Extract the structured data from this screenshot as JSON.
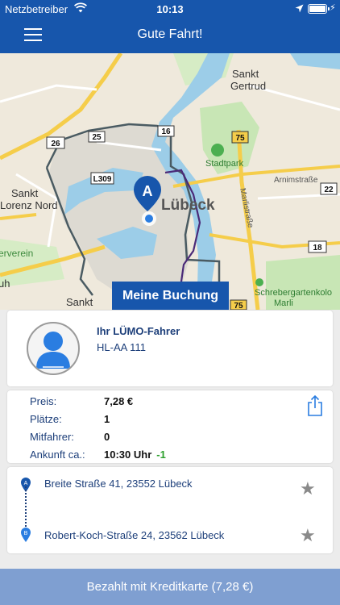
{
  "status_bar": {
    "carrier": "Netzbetreiber",
    "time": "10:13"
  },
  "nav": {
    "title": "Gute Fahrt!"
  },
  "map": {
    "labels": {
      "sankt_gertrud": [
        "Sankt",
        "Gertrud"
      ],
      "sankt_lorenz": [
        "Sankt",
        "Lorenz Nord"
      ],
      "stadtpark": "Stadtpark",
      "luebeck": "Lübeck",
      "arnimstrasse": "Arnimstraße",
      "marlistrasse": "Marlistraße",
      "schrebergarten": [
        "Schrebergartenkolo",
        "Marli"
      ],
      "erverein": "erverein",
      "uh": "uh",
      "sankt_bottom": "Sankt"
    },
    "road_shields": [
      "25",
      "16",
      "26",
      "75",
      "L309",
      "22",
      "18",
      "75"
    ],
    "marker_label": "A",
    "booking_button": "Meine Buchung"
  },
  "driver": {
    "title": "Ihr LÜMO-Fahrer",
    "plate": "HL-AA 111"
  },
  "booking": {
    "price_label": "Preis:",
    "price_value": "7,28 €",
    "seats_label": "Plätze:",
    "seats_value": "1",
    "passengers_label": "Mitfahrer:",
    "passengers_value": "0",
    "arrival_label": "Ankunft ca.:",
    "arrival_value": "10:30 Uhr",
    "arrival_delta": "-1"
  },
  "route": {
    "from_marker": "A",
    "from_address": "Breite Straße 41, 23552 Lübeck",
    "to_marker": "B",
    "to_address": "Robert-Koch-Straße 24, 23562 Lübeck"
  },
  "payment": {
    "label": "Bezahlt mit Kreditkarte (7,28 €)"
  },
  "colors": {
    "primary": "#1756ac",
    "payment_bar": "#7f9fd1",
    "text_blue": "#1d3f7a",
    "delta_green": "#2ca02c"
  }
}
